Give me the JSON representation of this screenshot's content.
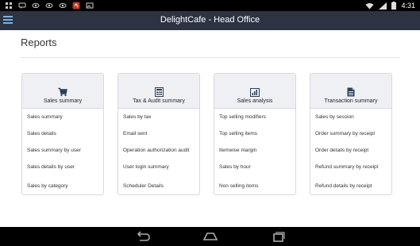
{
  "status_bar": {
    "time": "4:31",
    "left_icons": [
      "grid-icon",
      "message-icon",
      "eye-icon",
      "eye-icon",
      "eye-icon",
      "app-red-icon",
      "photo-icon"
    ],
    "right_icons": [
      "wifi-icon",
      "signal-icon",
      "battery-icon"
    ]
  },
  "app_bar": {
    "title": "DelightCafe - Head Office",
    "menu_icon": "hamburger-icon",
    "accent_color": "#7bb0e0",
    "background": "#2b3440"
  },
  "page": {
    "title": "Reports"
  },
  "cards": [
    {
      "title": "Sales summary",
      "icon": "cart-icon",
      "items": [
        "Sales summary",
        "Sales details",
        "Sales summary by user",
        "Sales details by user",
        "Sales by category"
      ]
    },
    {
      "title": "Tax & Audit summary",
      "icon": "calculator-icon",
      "items": [
        "Sales by tax",
        "Email sent",
        "Operation authorization audit",
        "User login summary",
        "Scheduler Details"
      ]
    },
    {
      "title": "Sales analysis",
      "icon": "bar-chart-icon",
      "items": [
        "Top selling modifiers",
        "Top selling items",
        "Itemwise margin",
        "Sales by hour",
        "Non selling items"
      ]
    },
    {
      "title": "Transaction summary",
      "icon": "document-icon",
      "items": [
        "Sales by session",
        "Order summary by receipt",
        "Order details by receipt",
        "Refund summary by receipt",
        "Refund details by receipt"
      ]
    }
  ],
  "nav_bar": {
    "buttons": [
      "back-icon",
      "home-icon",
      "recent-apps-icon"
    ]
  }
}
